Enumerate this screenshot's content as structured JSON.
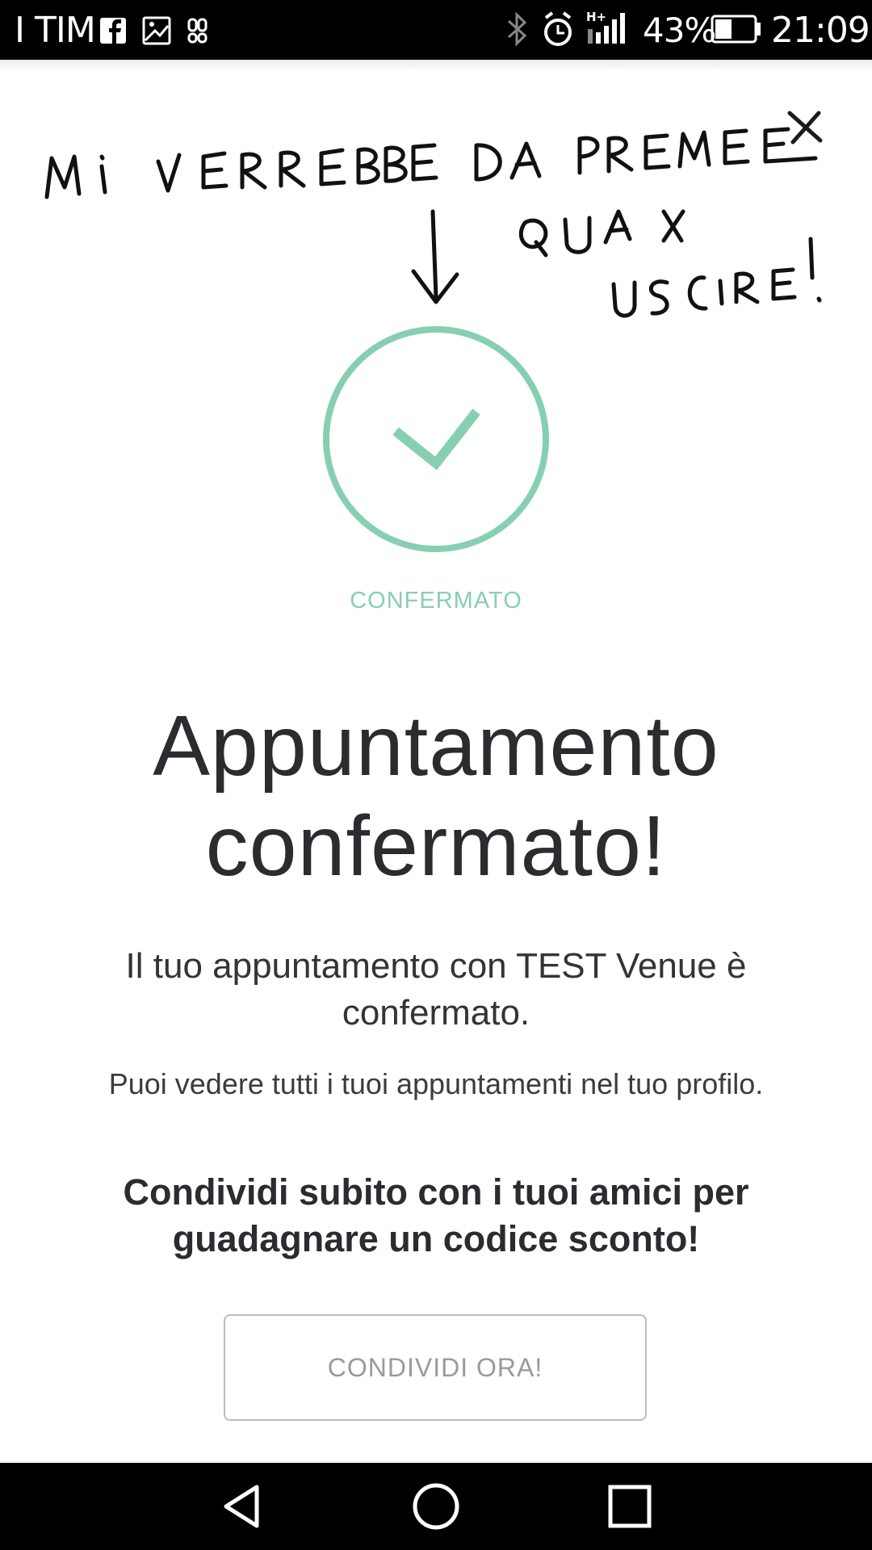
{
  "status_bar": {
    "carrier": "I TIM",
    "left_icons": [
      "facebook-icon",
      "gallery-icon",
      "android-notification-icon"
    ],
    "right_icons": [
      "bluetooth-icon",
      "alarm-icon",
      "signal-hplus-icon",
      "battery-icon"
    ],
    "network_type": "H+",
    "battery_percent": "43%",
    "battery_level": 0.43,
    "time": "21:09"
  },
  "annotation": {
    "line1": "MI VERREBBE DA PREMERE",
    "line2": "QUA X",
    "line3": "USCIRE!"
  },
  "confirmation": {
    "status_label": "CONFERMATO",
    "accent_color": "#87cfb1",
    "title": "Appuntamento confermato!",
    "message": "Il tuo appuntamento con TEST Venue è confermato.",
    "note": "Puoi vedere tutti i tuoi appuntamenti nel tuo profilo.",
    "share_prompt": "Condividi subito con i tuoi amici per guadagnare un codice sconto!",
    "share_button_label": "CONDIVIDI ORA!"
  },
  "nav_bar": {
    "buttons": [
      "back-icon",
      "home-icon",
      "recents-icon"
    ]
  }
}
